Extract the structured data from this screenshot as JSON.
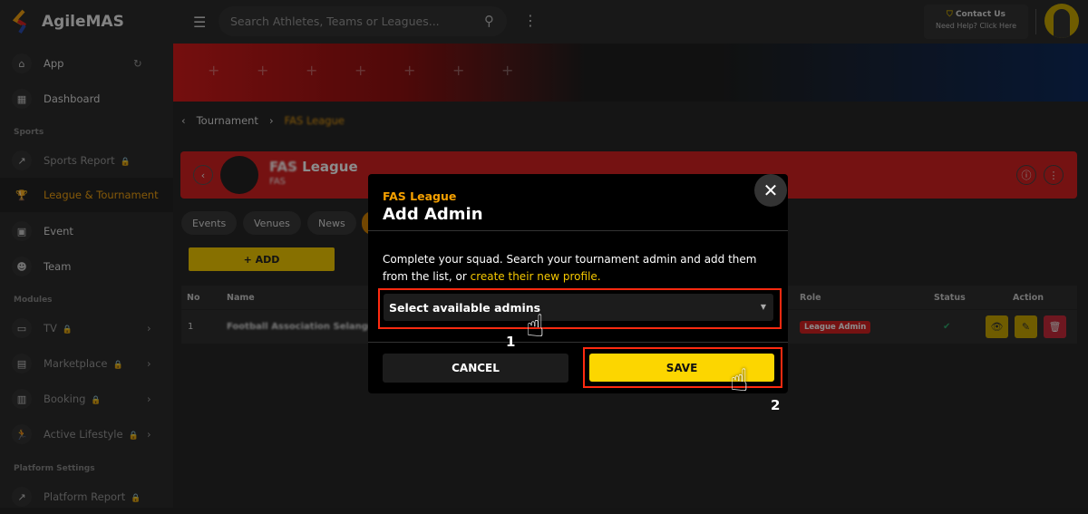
{
  "app": {
    "name": "AgileMAS"
  },
  "header": {
    "search_placeholder": "Search Athletes, Teams or Leagues...",
    "contact_title": "Contact Us",
    "contact_sub": "Need Help? Click Here"
  },
  "sidebar": {
    "items": [
      {
        "label": "App"
      },
      {
        "label": "Dashboard"
      },
      {
        "label": "Sports Report"
      },
      {
        "label": "League & Tournament"
      },
      {
        "label": "Event"
      },
      {
        "label": "Team"
      },
      {
        "label": "TV"
      },
      {
        "label": "Marketplace"
      },
      {
        "label": "Booking"
      },
      {
        "label": "Active Lifestyle"
      },
      {
        "label": "Platform Report"
      }
    ],
    "sections": [
      "Sports",
      "Modules",
      "Platform Settings"
    ]
  },
  "breadcrumb": {
    "parent": "Tournament",
    "current": "FAS League"
  },
  "card": {
    "title_blur": "FAS",
    "title": "League",
    "subtitle": "FAS"
  },
  "tabs": [
    "Events",
    "Venues",
    "News"
  ],
  "add_label": "+ ADD",
  "table": {
    "headers": {
      "no": "No",
      "name": "Name",
      "role": "Role",
      "status": "Status",
      "action": "Action"
    },
    "rows": [
      {
        "no": "1",
        "name": "Football Association Selangor",
        "role": "League Admin",
        "status": "active"
      }
    ]
  },
  "modal": {
    "league": "FAS League",
    "title": "Add Admin",
    "text": "Complete your squad. Search your tournament admin and add them from the list, or ",
    "link": "create their new profile.",
    "select_placeholder": "Select available admins",
    "cancel": "CANCEL",
    "save": "SAVE",
    "steps": [
      "1",
      "2"
    ]
  },
  "colors": {
    "accent": "#f5c800",
    "brand_red": "#d42020",
    "highlight": "#ff2a10",
    "league_orange": "#f5a000"
  }
}
